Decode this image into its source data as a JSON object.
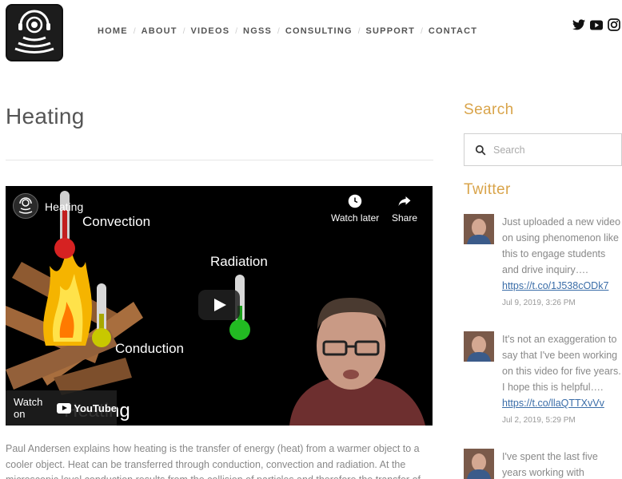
{
  "nav": {
    "items": [
      "HOME",
      "ABOUT",
      "VIDEOS",
      "NGSS",
      "CONSULTING",
      "SUPPORT",
      "CONTACT"
    ],
    "separator": "/"
  },
  "social": [
    "twitter-icon",
    "youtube-icon",
    "instagram-icon"
  ],
  "page": {
    "title": "Heating"
  },
  "video": {
    "title": "Heating",
    "watch_later": "Watch later",
    "share": "Share",
    "labels": {
      "convection": "Convection",
      "radiation": "Radiation",
      "conduction": "Conduction",
      "big_title": "Heating"
    },
    "watch_on": "Watch on",
    "youtube": "YouTube"
  },
  "description": "Paul Andersen explains how heating is the transfer of energy (heat) from a warmer object to a cooler object.  Heat can be transferred through conduction, convection and radiation.  At the microscopic level conduction results from the collision of particles and therefore the transfer of",
  "sidebar": {
    "search_heading": "Search",
    "search_placeholder": "Search",
    "twitter_heading": "Twitter",
    "tweets": [
      {
        "text": "Just uploaded a new video on using phenomenon like this to engage students and drive inquiry….",
        "link": "https://t.co/1J538cODk7",
        "time": "Jul 9, 2019, 3:26 PM"
      },
      {
        "text": "It's not an exaggeration to say that I've been working on this video for five years. I hope this is helpful….",
        "link": "https://t.co/llaQTTXvVv",
        "time": "Jul 2, 2019, 5:29 PM"
      },
      {
        "text": "I've spent the last five years working with",
        "link": "",
        "time": ""
      }
    ]
  },
  "colors": {
    "accent": "#d9a44a",
    "link": "#3a6da8",
    "text_muted": "#888888"
  }
}
